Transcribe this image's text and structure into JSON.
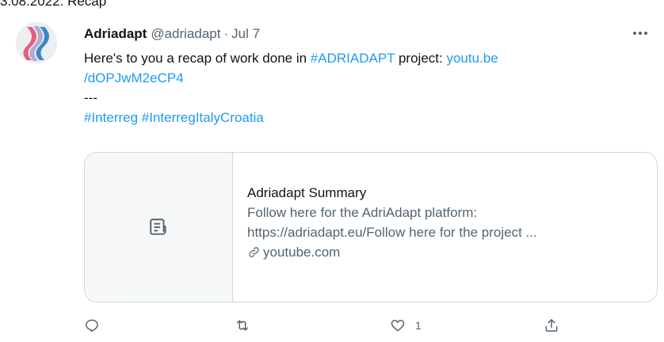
{
  "caption": "3.08.2022. Recap",
  "tweet": {
    "display_name": "Adriadapt",
    "handle": "@adriadapt",
    "separator": "·",
    "date": "Jul 7",
    "text_prefix": "Here's to you a recap of work done in ",
    "hashtag_project": "#ADRIADAPT",
    "text_mid": " project: ",
    "link_part1": "youtu.be",
    "link_part2": "/dOPJwM2eCP4",
    "divider": "---",
    "hashtag_interreg": "#Interreg",
    "hashtag_italy_croatia": "#InterregItalyCroatia"
  },
  "card": {
    "title": "Adriadapt Summary",
    "desc_line1": "Follow here for the AdriAdapt platform:",
    "desc_line2": "https://adriadapt.eu/Follow here for the project ...",
    "domain": "youtube.com"
  },
  "actions": {
    "reply_count": "",
    "retweet_count": "",
    "like_count": "1"
  },
  "colors": {
    "link": "#1d9bf0",
    "muted": "#536471",
    "text": "#0f1419",
    "border": "#cfd9de"
  },
  "icons": {
    "more": "more-icon",
    "reply": "reply-icon",
    "retweet": "retweet-icon",
    "like": "heart-icon",
    "share": "share-icon",
    "card_thumb": "document-icon",
    "card_domain": "link-icon"
  }
}
